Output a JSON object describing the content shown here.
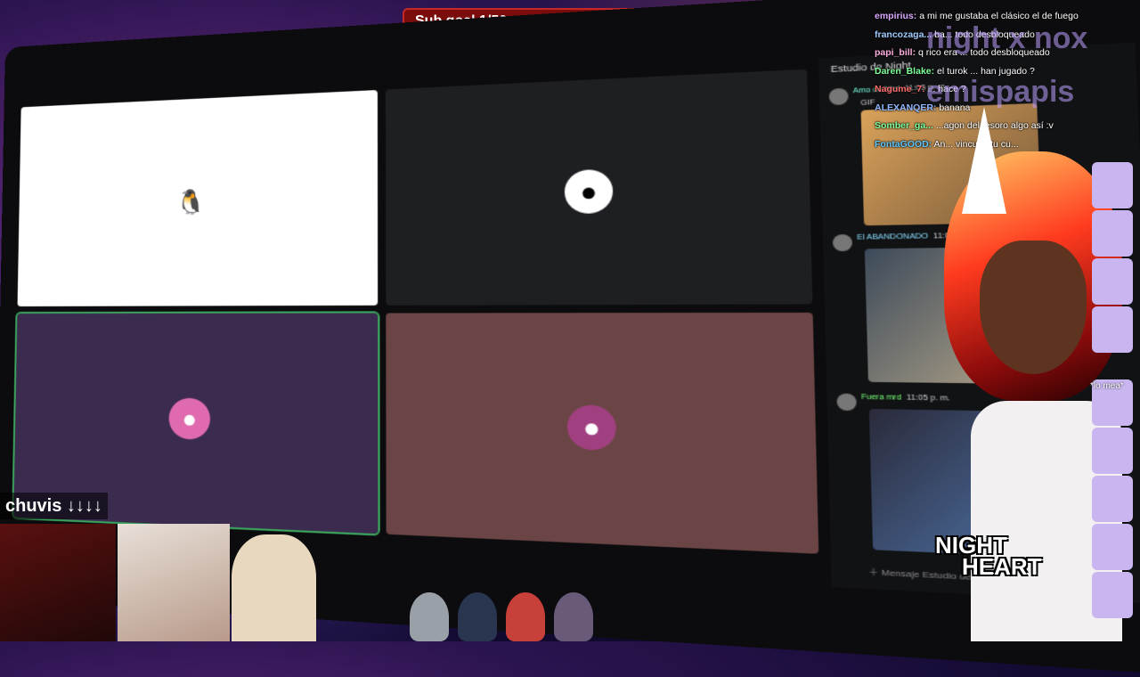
{
  "subgoal": {
    "label": "Sub goal 1/50",
    "progress": 0.02
  },
  "discord": {
    "channel_title": "Estudio de Night",
    "tiles": [
      {
        "name": "tile-penguin",
        "avatar_icon": "penguin-icon"
      },
      {
        "name": "tile-dark",
        "avatar_icon": "user-avatar-icon"
      },
      {
        "name": "tile-purple",
        "avatar_icon": "user-avatar-icon"
      },
      {
        "name": "tile-red",
        "avatar_icon": "user-avatar-icon"
      }
    ],
    "messages": [
      {
        "author": "Amo de Niel",
        "time": "11:05 p. m.",
        "note": "GIF"
      },
      {
        "author": "El ABANDONADO",
        "time": "11:05 p. m."
      },
      {
        "author": "Fuera mrd",
        "time": "11:05 p. m."
      }
    ],
    "input_placeholder": "Mensaje Estudio de Night"
  },
  "chat": [
    {
      "user": "empirius:",
      "text": "a mi me gustaba el clásico el de fuego",
      "color": "#d9a8ff"
    },
    {
      "user": "francozaga...",
      "text": "ba... todo desbloqueado",
      "color": "#9ecbff"
    },
    {
      "user": "papi_bill:",
      "text": "q rico era ... todo desbloqueado",
      "color": "#ffb0e0"
    },
    {
      "user": "Daren_Blake:",
      "text": "el turok ... han jugado ?",
      "color": "#7fff9a"
    },
    {
      "user": "Nagume_7:",
      "text": "... hace ?",
      "color": "#ff6b6b"
    },
    {
      "user": "ALEXANQER:",
      "text": "banana",
      "color": "#8fb8ff"
    },
    {
      "user": "Somber_ga...",
      "text": "...agon del tesoro algo así :v",
      "color": "#7fff9a"
    },
    {
      "user": "FontaGOOD:",
      "text": "An... vincular tu cu...",
      "color": "#5ec8ff"
    }
  ],
  "overlay_texts": [
    "night x nox",
    "emispapis"
  ],
  "emote_caption": "*lo mea*",
  "brand": {
    "line1": "NIGHT",
    "line2": "HEART"
  },
  "chuvis_label": "chuvis ↓↓↓↓"
}
